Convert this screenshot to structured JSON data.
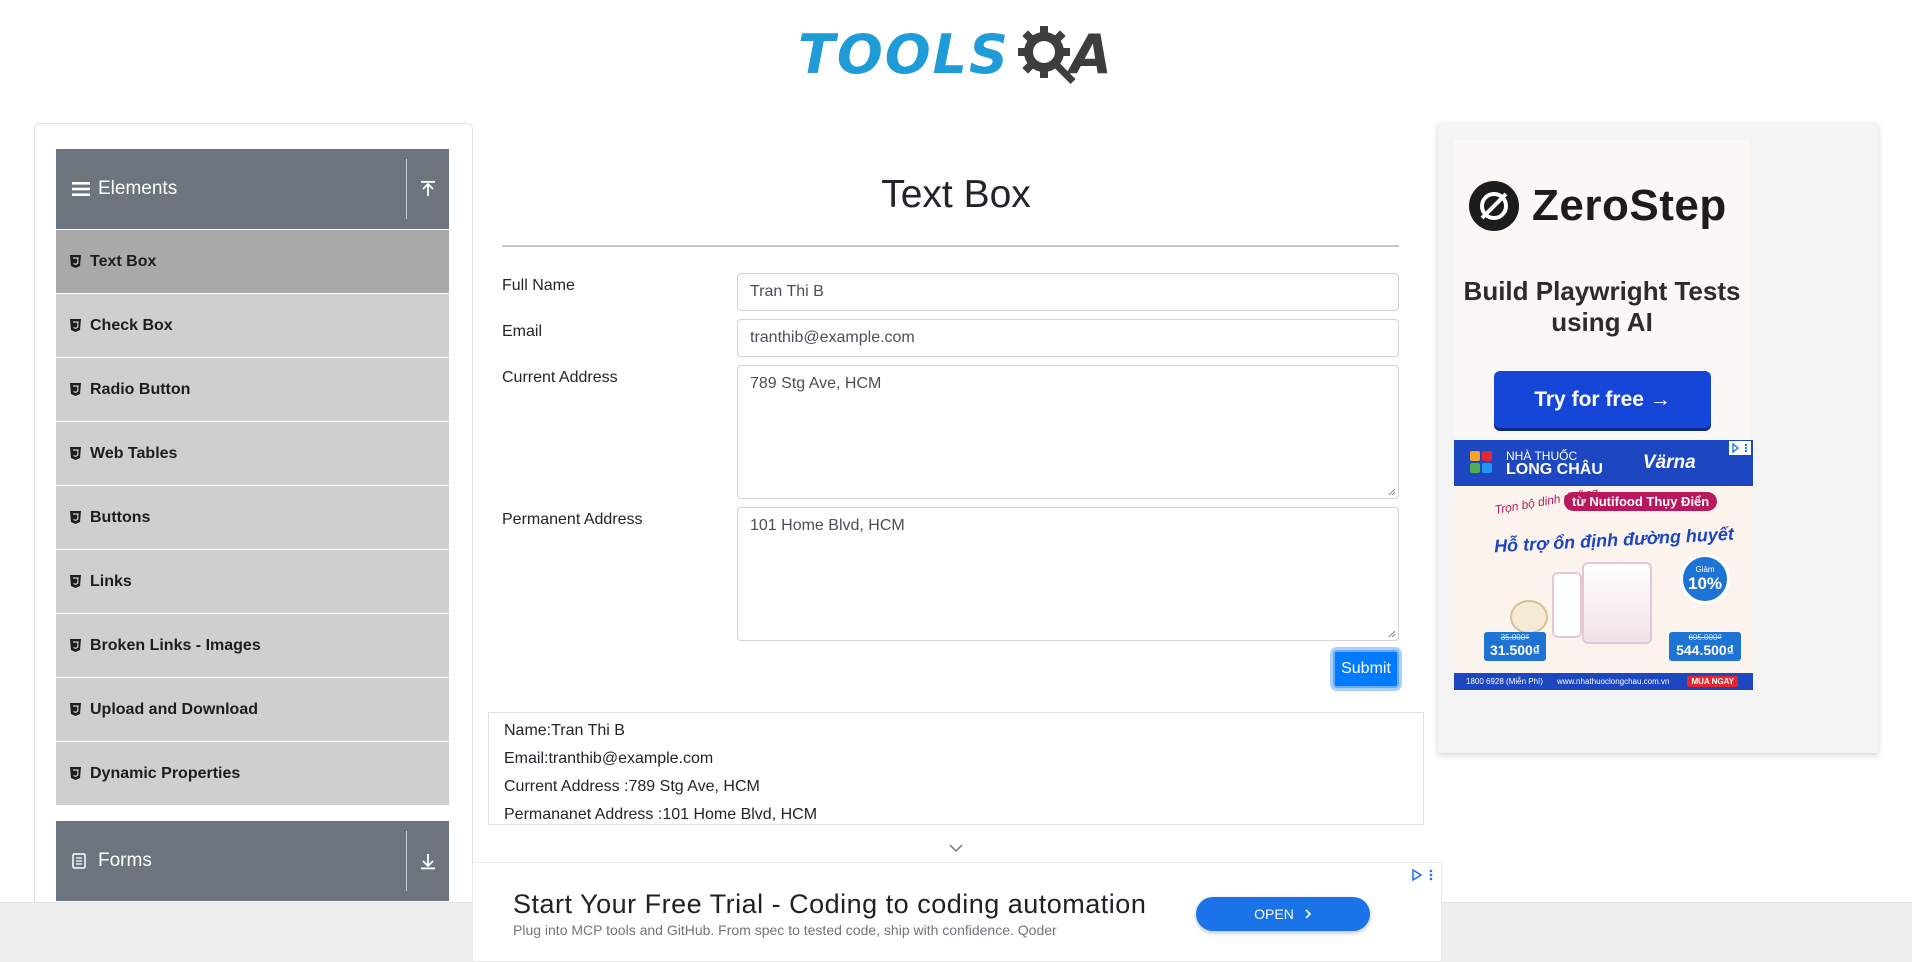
{
  "header": {
    "logo_left": "TOOLS",
    "logo_right": "QA"
  },
  "sidebar": {
    "elements_group": {
      "title": "Elements"
    },
    "items": [
      {
        "label": "Text Box",
        "active": true
      },
      {
        "label": "Check Box"
      },
      {
        "label": "Radio Button"
      },
      {
        "label": "Web Tables"
      },
      {
        "label": "Buttons"
      },
      {
        "label": "Links"
      },
      {
        "label": "Broken Links - Images"
      },
      {
        "label": "Upload and Download"
      },
      {
        "label": "Dynamic Properties"
      }
    ],
    "forms_group": {
      "title": "Forms"
    }
  },
  "main": {
    "title": "Text Box",
    "form": {
      "full_name": {
        "label": "Full Name",
        "value": "Tran Thi B"
      },
      "email": {
        "label": "Email",
        "value": "tranthib@example.com"
      },
      "current_address": {
        "label": "Current Address",
        "value": "789 Stg Ave, HCM"
      },
      "permanent_address": {
        "label": "Permanent Address",
        "value": "101 Home Blvd, HCM"
      },
      "submit_label": "Submit"
    },
    "output": {
      "name": "Name:Tran Thi B",
      "email": "Email:tranthib@example.com",
      "current_address": "Current Address :789 Stg Ave, HCM",
      "permanent_address": "Permananet Address :101 Home Blvd, HCM"
    }
  },
  "right_ad": {
    "brand": "ZeroStep",
    "tagline": "Build Playwright Tests using AI",
    "cta": "Try for free →",
    "pharmacy_ad": {
      "retailer_small": "NHÀ THUỐC",
      "retailer": "LONG CHÂU",
      "product": "Värna",
      "headline_small": "Trọn bộ dinh dưỡng",
      "pill": "từ Nutifood Thụy Điển",
      "headline": "Hỗ trợ ổn định đường huyết",
      "discount_small": "Giảm",
      "discount": "10%",
      "price1_old": "35.000₫",
      "price1": "31.500₫",
      "price2_old": "605.000₫",
      "price2": "544.500₫",
      "hotline": "1800 6928 (Miễn Phí)",
      "site": "www.nhathuoclongchau.com.vn",
      "buy": "MUA NGAY"
    }
  },
  "bottom_ad": {
    "title": "Start Your Free Trial - Coding to coding automation",
    "description": "Plug into MCP tools and GitHub. From spec to tested code, ship with confidence. Qoder",
    "cta": "OPEN"
  },
  "colors": {
    "logo_blue": "#1f9bd7",
    "sidebar_header": "#6c757d",
    "menu_item": "#cfcfcf",
    "menu_active": "#a9a9a9",
    "primary": "#007bff"
  }
}
